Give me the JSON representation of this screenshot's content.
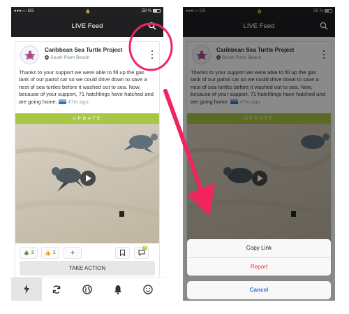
{
  "status_bar": {
    "carrier": "●●●○○ GS",
    "battery": "58 %"
  },
  "header": {
    "title": "LIVE Feed"
  },
  "post": {
    "org_name": "Caribbean Sea Turtle Project",
    "location": "South Palm Beach",
    "text": "Thanks to your support we were able to fill up the gas tank of our patrol car so we could drive down to save a nest of sea turtles before it washed out to sea. Now, because of your support, 71 hatchlings have hatched and are going home.",
    "time": "47m ago",
    "tag": "UPDATE",
    "reactions": {
      "turtle_count": "3",
      "thumbs_count": "1",
      "add_label": "+",
      "comment_count": "3"
    },
    "take_action_label": "TAKE ACTION"
  },
  "tabbar": {
    "tabs": [
      "lightning-icon",
      "refresh-icon",
      "globe-icon",
      "bell-icon",
      "smiley-icon"
    ]
  },
  "action_sheet": {
    "items": [
      "Copy Link",
      "Report"
    ],
    "cancel_label": "Cancel"
  },
  "colors": {
    "accent_green": "#a9c545",
    "report_red": "#e0344a",
    "cancel_blue": "#2f7ad6",
    "annotation_pink": "#f0245e"
  }
}
